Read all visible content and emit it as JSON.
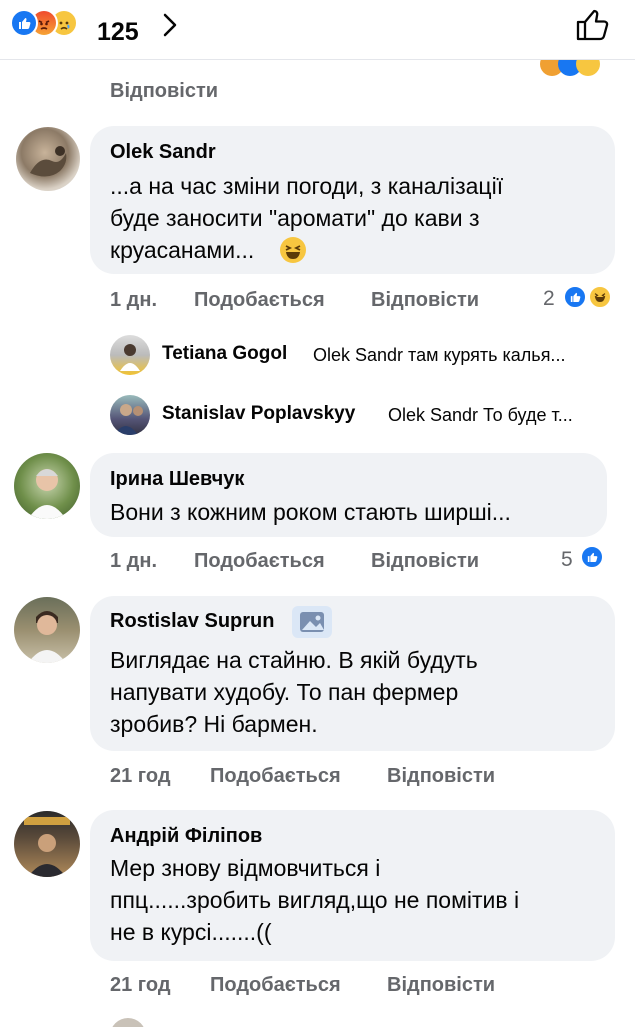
{
  "header": {
    "reaction_count": "125",
    "like_color": "#1877f2"
  },
  "previous_comment": {
    "reply_label": "Відповісти"
  },
  "comments": [
    {
      "author": "Olek Sandr",
      "text": "...а на час зміни погоди, з каналізації\nбуде заносити \"аромати\" до кави з\nкруасанами...",
      "emoji": "laughing-emoji",
      "time": "1 дн.",
      "like_label": "Подобається",
      "reply_label": "Відповісти",
      "reactions_count": "2",
      "replies": [
        {
          "author": "Tetiana Gogol",
          "text": "Olek Sandr там курять калья..."
        },
        {
          "author": "Stanislav Poplavskyy",
          "text": "Olek Sandr То буде т..."
        }
      ]
    },
    {
      "author": "Ірина Шевчук",
      "text": "Вони з кожним роком стають ширші...",
      "time": "1 дн.",
      "like_label": "Подобається",
      "reply_label": "Відповісти",
      "reactions_count": "5"
    },
    {
      "author": "Rostislav Suprun",
      "badge_icon": "image-badge-icon",
      "text": "Виглядає на стайню. В якій будуть\nнапувати худобу. То пан фермер\nзробив? Ні бармен.",
      "time": "21 год",
      "like_label": "Подобається",
      "reply_label": "Відповісти"
    },
    {
      "author": "Андрій Філіпов",
      "text": "Мер знову відмовчиться і\nппц......зробить вигляд,що не помітив і\nне в курсі.......((",
      "time": "21 год",
      "like_label": "Подобається",
      "reply_label": "Відповісти"
    }
  ]
}
